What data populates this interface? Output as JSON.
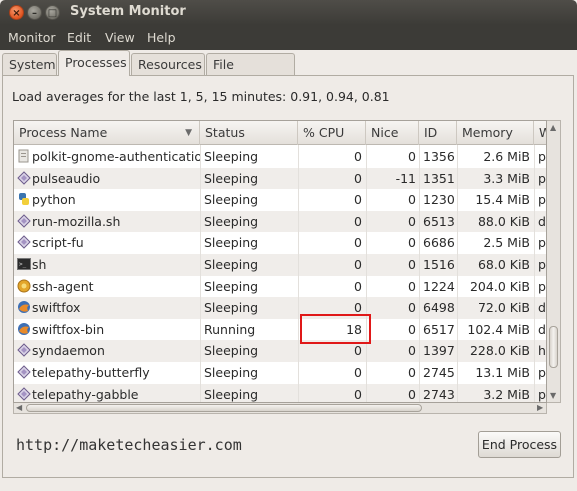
{
  "window": {
    "title": "System Monitor"
  },
  "menu": [
    "Monitor",
    "Edit",
    "View",
    "Help"
  ],
  "tabs": [
    "System",
    "Processes",
    "Resources",
    "File Systems"
  ],
  "active_tab": "Processes",
  "load_averages": "Load averages for the last 1, 5, 15 minutes: 0.91, 0.94, 0.81",
  "columns": [
    "Process Name",
    "Status",
    "% CPU",
    "Nice",
    "ID",
    "Memory",
    "W"
  ],
  "processes": [
    {
      "name": "polkit-gnome-authenticatio",
      "status": "Sleeping",
      "cpu": "0",
      "nice": "0",
      "id": "1356",
      "memory": "2.6 MiB",
      "extra": "p",
      "icon": "generic-process-icon"
    },
    {
      "name": "pulseaudio",
      "status": "Sleeping",
      "cpu": "0",
      "nice": "-11",
      "id": "1351",
      "memory": "3.3 MiB",
      "extra": "p",
      "icon": "diamond-process-icon"
    },
    {
      "name": "python",
      "status": "Sleeping",
      "cpu": "0",
      "nice": "0",
      "id": "1230",
      "memory": "15.4 MiB",
      "extra": "p",
      "icon": "python-icon"
    },
    {
      "name": "run-mozilla.sh",
      "status": "Sleeping",
      "cpu": "0",
      "nice": "0",
      "id": "6513",
      "memory": "88.0 KiB",
      "extra": "d",
      "icon": "diamond-process-icon"
    },
    {
      "name": "script-fu",
      "status": "Sleeping",
      "cpu": "0",
      "nice": "0",
      "id": "6686",
      "memory": "2.5 MiB",
      "extra": "p",
      "icon": "diamond-process-icon"
    },
    {
      "name": "sh",
      "status": "Sleeping",
      "cpu": "0",
      "nice": "0",
      "id": "1516",
      "memory": "68.0 KiB",
      "extra": "p",
      "icon": "terminal-icon"
    },
    {
      "name": "ssh-agent",
      "status": "Sleeping",
      "cpu": "0",
      "nice": "0",
      "id": "1224",
      "memory": "204.0 KiB",
      "extra": "p",
      "icon": "key-icon"
    },
    {
      "name": "swiftfox",
      "status": "Sleeping",
      "cpu": "0",
      "nice": "0",
      "id": "6498",
      "memory": "72.0 KiB",
      "extra": "d",
      "icon": "swiftfox-icon"
    },
    {
      "name": "swiftfox-bin",
      "status": "Running",
      "cpu": "18",
      "nice": "0",
      "id": "6517",
      "memory": "102.4 MiB",
      "extra": "d",
      "icon": "swiftfox-icon"
    },
    {
      "name": "syndaemon",
      "status": "Sleeping",
      "cpu": "0",
      "nice": "0",
      "id": "1397",
      "memory": "228.0 KiB",
      "extra": "h",
      "icon": "diamond-process-icon"
    },
    {
      "name": "telepathy-butterfly",
      "status": "Sleeping",
      "cpu": "0",
      "nice": "0",
      "id": "2745",
      "memory": "13.1 MiB",
      "extra": "p",
      "icon": "diamond-process-icon"
    },
    {
      "name": "telepathy-gabble",
      "status": "Sleeping",
      "cpu": "0",
      "nice": "0",
      "id": "2743",
      "memory": "3.2 MiB",
      "extra": "p",
      "icon": "diamond-process-icon"
    }
  ],
  "watermark": "http://maketecheasier.com",
  "end_process_label": "End Process"
}
